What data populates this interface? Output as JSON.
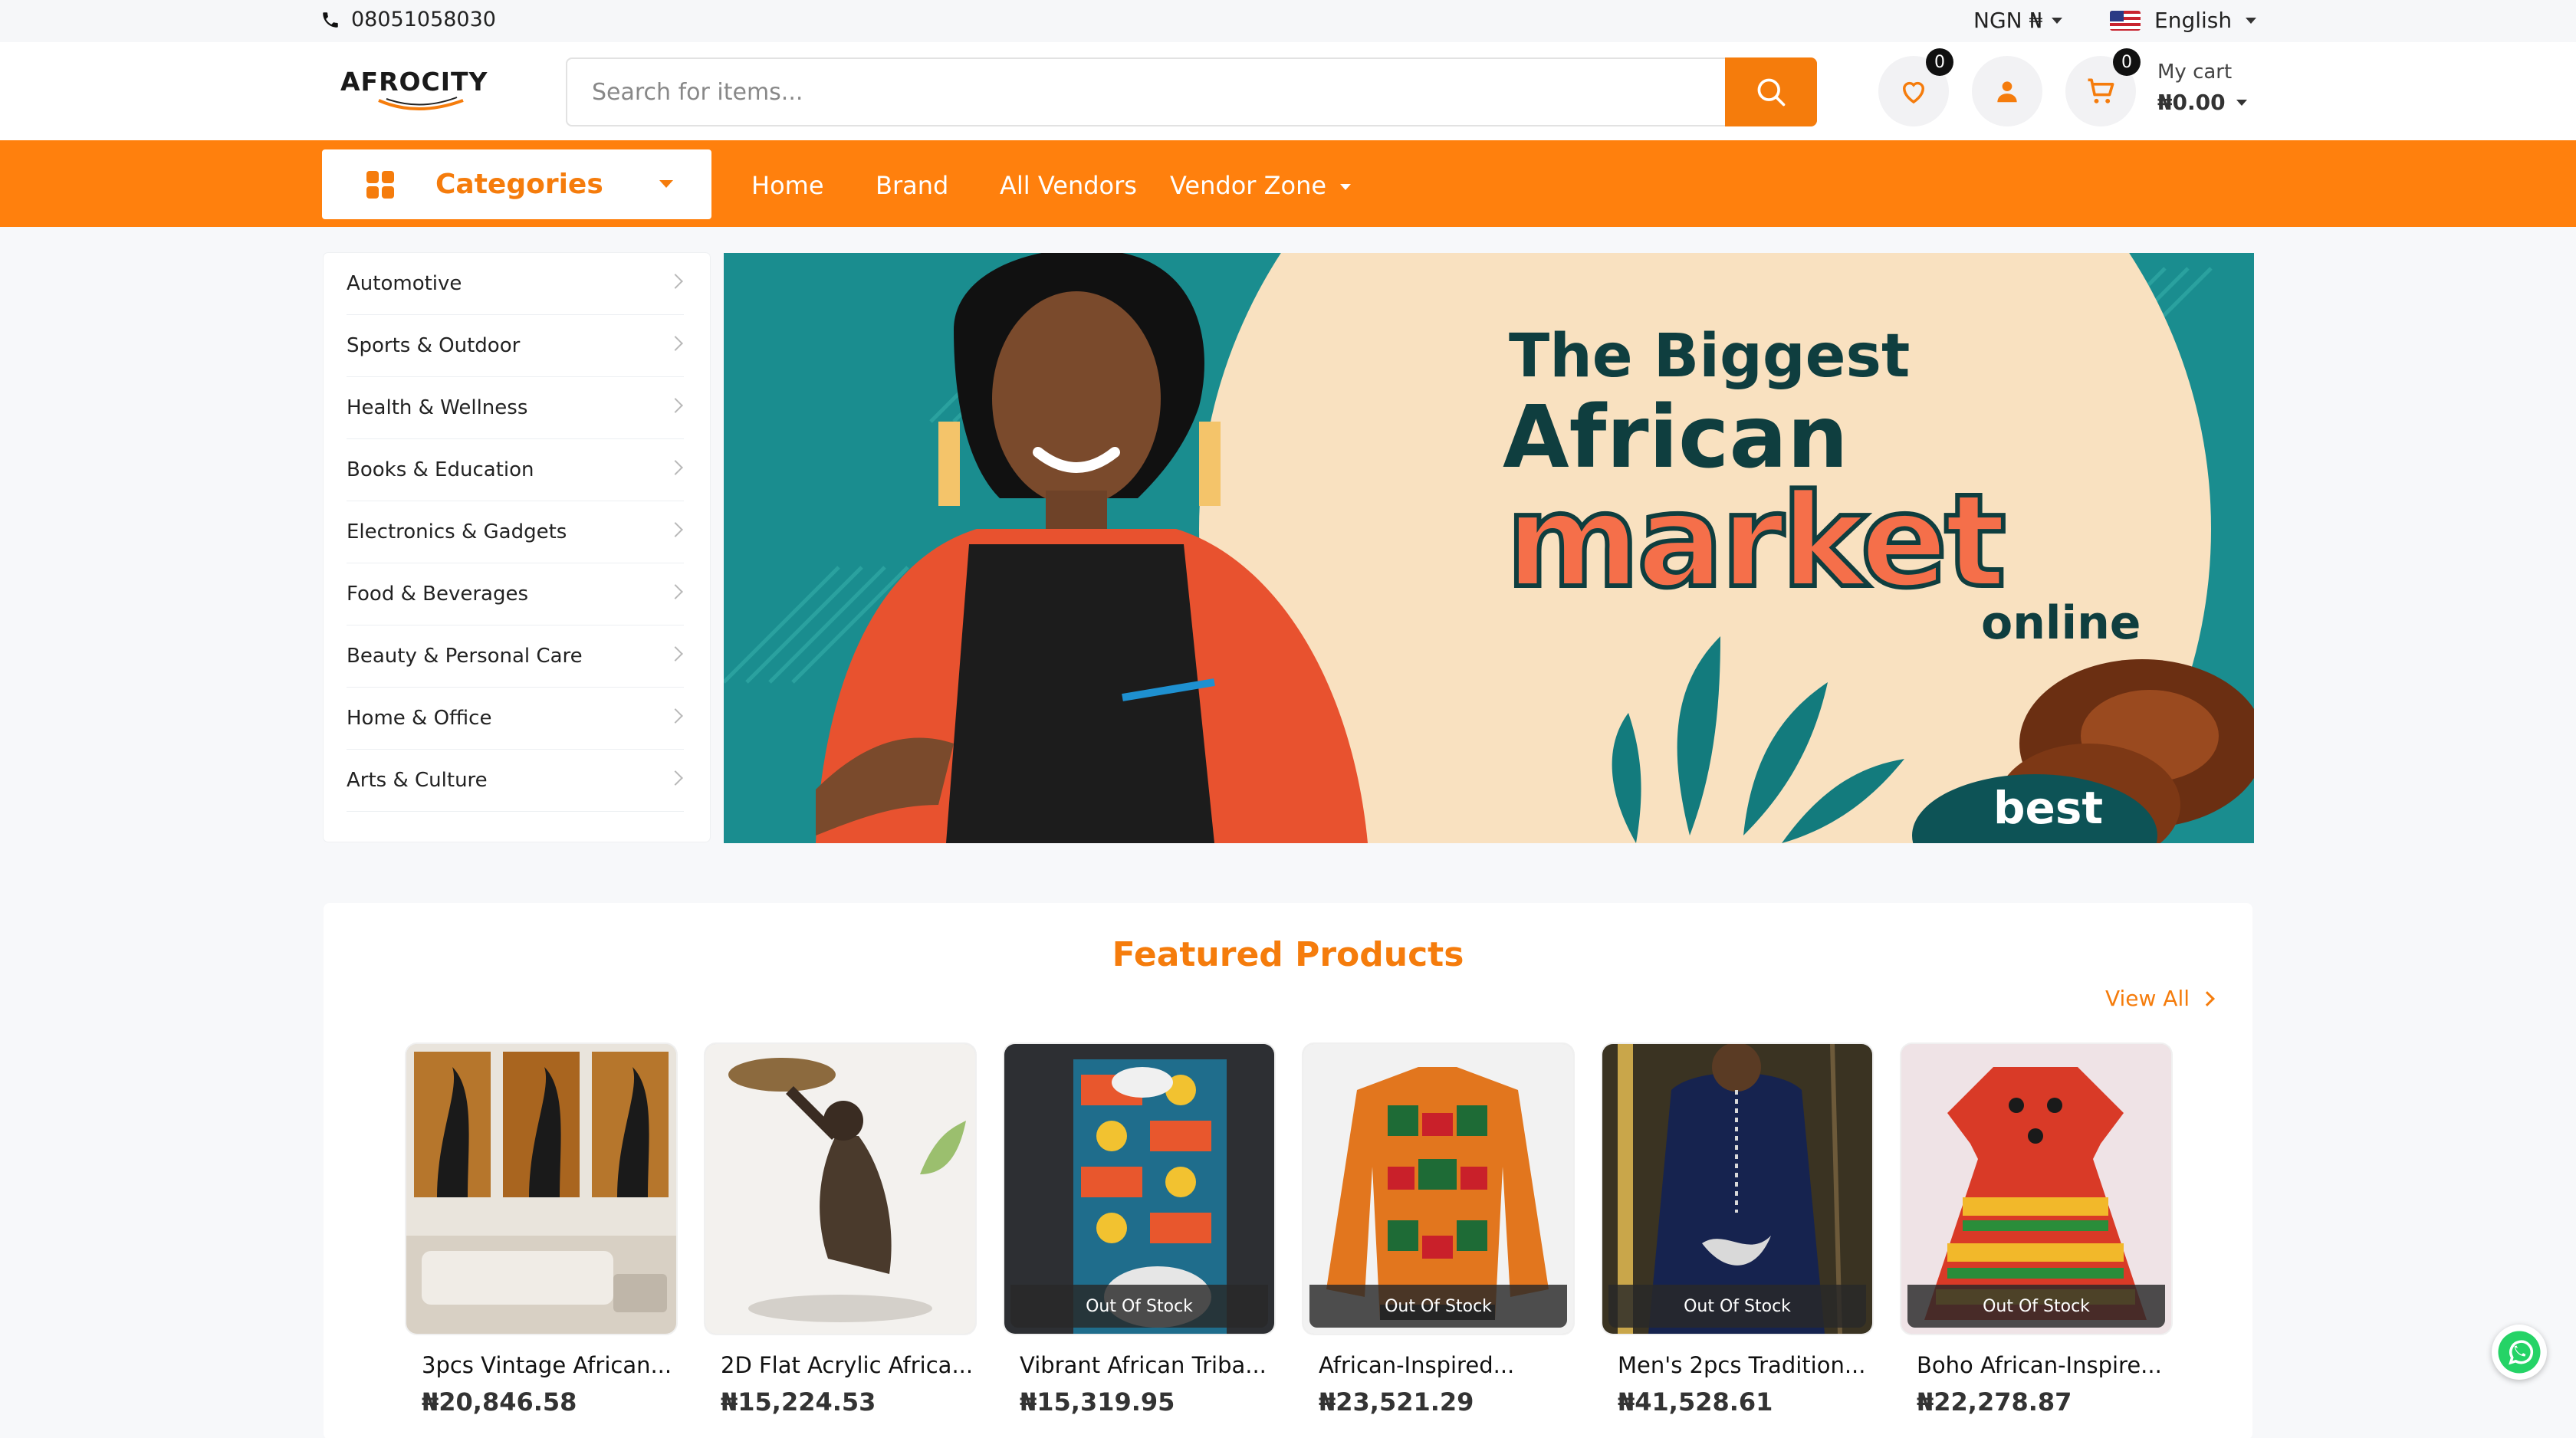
{
  "topbar": {
    "phone": "08051058030",
    "currency": "NGN ₦",
    "language": "English"
  },
  "header": {
    "logo_text": "AFROCITY",
    "search_placeholder": "Search for items...",
    "wishlist_count": "0",
    "cart_count": "0",
    "cart_label": "My cart",
    "cart_total": "₦0.00"
  },
  "nav": {
    "categories_label": "Categories",
    "links": [
      "Home",
      "Brand",
      "All Vendors",
      "Vendor Zone"
    ]
  },
  "sidebar": {
    "categories": [
      "Automotive",
      "Sports & Outdoor",
      "Health & Wellness",
      "Books & Education",
      "Electronics & Gadgets",
      "Food & Beverages",
      "Beauty & Personal Care",
      "Home & Office",
      "Arts & Culture"
    ]
  },
  "banner": {
    "line1": "The Biggest",
    "line2": "African",
    "line3": "market",
    "line4": "online",
    "corner": "best",
    "bg_color": "#1a8d8f",
    "circle_color": "#f9e1c0",
    "accent_color": "#f56f4a"
  },
  "featured": {
    "title": "Featured Products",
    "view_all": "View All",
    "products": [
      {
        "name": "3pcs Vintage African...",
        "price": "₦20,846.58",
        "stock": ""
      },
      {
        "name": "2D Flat Acrylic Africa...",
        "price": "₦15,224.53",
        "stock": ""
      },
      {
        "name": "Vibrant African Triba...",
        "price": "₦15,319.95",
        "stock": "Out Of Stock"
      },
      {
        "name": "African-Inspired...",
        "price": "₦23,521.29",
        "stock": "Out Of Stock"
      },
      {
        "name": "Men's 2pcs Tradition...",
        "price": "₦41,528.61",
        "stock": "Out Of Stock"
      },
      {
        "name": "Boho African-Inspire...",
        "price": "₦22,278.87",
        "stock": "Out Of Stock"
      }
    ]
  },
  "colors": {
    "brand_orange": "#ff800d",
    "text_orange": "#f57c0c"
  }
}
